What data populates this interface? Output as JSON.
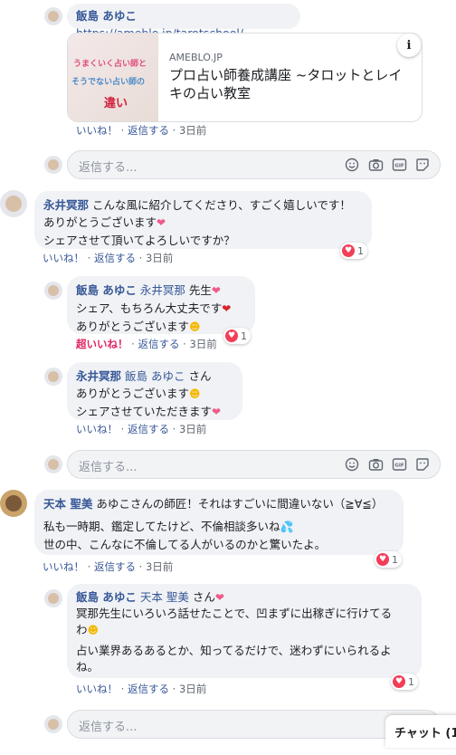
{
  "link_comment": {
    "author": "飯島 あゆこ",
    "url": "https://ameblo.jp/tarotschool/",
    "card_domain": "AMEBLO.JP",
    "card_title": "プロ占い師養成講座 ~タロットとレイキの占い教室",
    "thumb_line1": "うまくいく占い師と",
    "thumb_line2": "そうでない占い師の",
    "thumb_line3": "違い",
    "info_label": "i",
    "like": "いいね！",
    "reply": "返信する",
    "time": "3日前"
  },
  "reply_box_placeholder": "返信する...",
  "comment1": {
    "author": "永井冥那",
    "line1": "こんな風に紹介してくださり、すごく嬉しいです！",
    "line2": "ありがとうございます",
    "line3": "シェアさせて頂いてよろしいですか？",
    "reaction_count": "1",
    "like": "いいね！",
    "reply": "返信する",
    "time": "3日前"
  },
  "reply1": {
    "author": "飯島 あゆこ",
    "mention": "永井冥那",
    "suffix": "先生",
    "line2": "シェア、もちろん大丈夫です",
    "line3": "ありがとうございます",
    "reaction_count": "1",
    "like": "超いいね！",
    "reply": "返信する",
    "time": "3日前"
  },
  "reply2": {
    "author": "永井冥那",
    "mention": "飯島 あゆこ",
    "suffix": "さん",
    "line2": "ありがとうございます",
    "line3": "シェアさせていただきます",
    "like": "いいね！",
    "reply": "返信する",
    "time": "3日前"
  },
  "comment2": {
    "author": "天本 聖美",
    "line1": "あゆこさんの師匠！それはすごいに間違いない（≧∀≦）",
    "line2": "私も一時期、鑑定してたけど、不倫相談多いね",
    "line3": "世の中、こんなに不倫してる人がいるのかと驚いたよ。",
    "reaction_count": "1",
    "like": "いいね！",
    "reply": "返信する",
    "time": "3日前"
  },
  "reply3": {
    "author": "飯島 あゆこ",
    "mention": "天本 聖美",
    "suffix": "さん",
    "line2": "冥那先生にいろいろ話せたことで、凹まずに出稼ぎに行けてる",
    "line3": "わ",
    "line4": "占い業界あるあるとか、知ってるだけで、迷わずにいられるよ",
    "line5": "ね。",
    "reaction_count": "1",
    "like": "いいね！",
    "reply": "返信する",
    "time": "3日前"
  },
  "chat_tab": "チャット (1",
  "sep": "·",
  "colors": {
    "link": "#385898",
    "heart": "#f33e58",
    "super": "#e0245e",
    "bubble": "#f0f2f5"
  },
  "icons": [
    "smiley-icon",
    "camera-icon",
    "gif-icon",
    "sticker-icon",
    "heart-emoji-icon",
    "grin-emoji-icon",
    "sweat-drops-emoji-icon"
  ]
}
